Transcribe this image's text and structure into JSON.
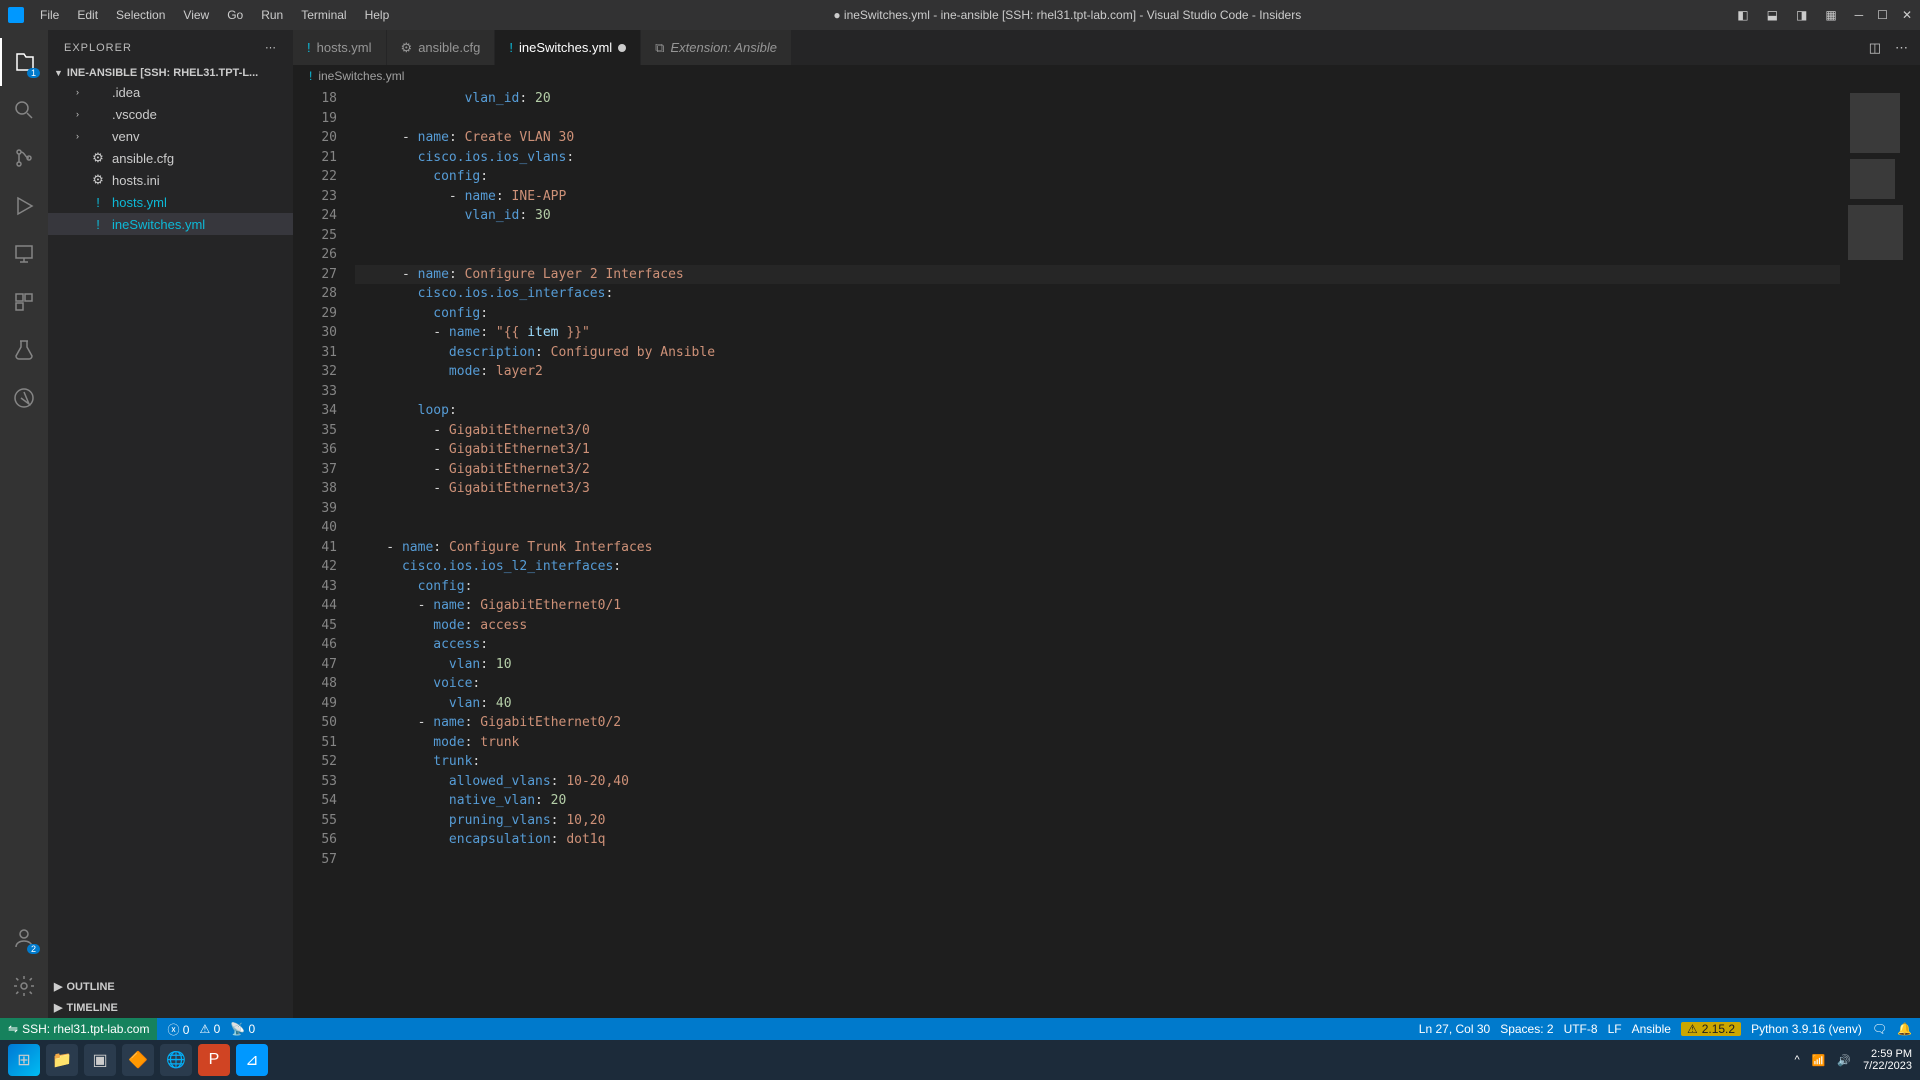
{
  "titlebar": {
    "menus": [
      "File",
      "Edit",
      "Selection",
      "View",
      "Go",
      "Run",
      "Terminal",
      "Help"
    ],
    "title": "● ineSwitches.yml - ine-ansible [SSH: rhel31.tpt-lab.com] - Visual Studio Code - Insiders"
  },
  "sidebar": {
    "header": "EXPLORER",
    "repo": "INE-ANSIBLE [SSH: RHEL31.TPT-L...",
    "files": [
      {
        "label": ".idea",
        "type": "folder"
      },
      {
        "label": ".vscode",
        "type": "folder"
      },
      {
        "label": "venv",
        "type": "folder"
      },
      {
        "label": "ansible.cfg",
        "type": "file",
        "icon": "⚙"
      },
      {
        "label": "hosts.ini",
        "type": "file",
        "icon": "⚙"
      },
      {
        "label": "hosts.yml",
        "type": "file",
        "icon": "!",
        "warn": true
      },
      {
        "label": "ineSwitches.yml",
        "type": "file",
        "icon": "!",
        "warn": true,
        "selected": true
      }
    ],
    "outline": "OUTLINE",
    "timeline": "TIMELINE"
  },
  "tabs": [
    {
      "label": "hosts.yml",
      "icon": "!",
      "warn": true
    },
    {
      "label": "ansible.cfg",
      "icon": "⚙"
    },
    {
      "label": "ineSwitches.yml",
      "icon": "!",
      "warn": true,
      "active": true,
      "dirty": true
    },
    {
      "label": "Extension: Ansible",
      "icon": "⧉",
      "italic": true
    }
  ],
  "breadcrumb": {
    "icon": "!",
    "label": "ineSwitches.yml"
  },
  "code_lines": [
    {
      "n": 18,
      "seg": [
        {
          "t": "              ",
          "c": "def"
        },
        {
          "t": "vlan_id",
          "c": "key"
        },
        {
          "t": ": ",
          "c": "def"
        },
        {
          "t": "20",
          "c": "num"
        }
      ]
    },
    {
      "n": 19,
      "seg": []
    },
    {
      "n": 20,
      "seg": [
        {
          "t": "      - ",
          "c": "def"
        },
        {
          "t": "name",
          "c": "key"
        },
        {
          "t": ": ",
          "c": "def"
        },
        {
          "t": "Create VLAN 30",
          "c": "txt"
        }
      ]
    },
    {
      "n": 21,
      "seg": [
        {
          "t": "        ",
          "c": "def"
        },
        {
          "t": "cisco.ios.ios_vlans",
          "c": "key"
        },
        {
          "t": ":",
          "c": "def"
        }
      ]
    },
    {
      "n": 22,
      "seg": [
        {
          "t": "          ",
          "c": "def"
        },
        {
          "t": "config",
          "c": "key"
        },
        {
          "t": ":",
          "c": "def"
        }
      ]
    },
    {
      "n": 23,
      "seg": [
        {
          "t": "            - ",
          "c": "def"
        },
        {
          "t": "name",
          "c": "key"
        },
        {
          "t": ": ",
          "c": "def"
        },
        {
          "t": "INE-APP",
          "c": "txt"
        }
      ]
    },
    {
      "n": 24,
      "seg": [
        {
          "t": "              ",
          "c": "def"
        },
        {
          "t": "vlan_id",
          "c": "key"
        },
        {
          "t": ": ",
          "c": "def"
        },
        {
          "t": "30",
          "c": "num"
        }
      ]
    },
    {
      "n": 25,
      "seg": []
    },
    {
      "n": 26,
      "seg": []
    },
    {
      "n": 27,
      "hl": true,
      "seg": [
        {
          "t": "      - ",
          "c": "def"
        },
        {
          "t": "name",
          "c": "key"
        },
        {
          "t": ": ",
          "c": "def"
        },
        {
          "t": "Configure Layer 2 Interfaces",
          "c": "txt"
        }
      ]
    },
    {
      "n": 28,
      "seg": [
        {
          "t": "        ",
          "c": "def"
        },
        {
          "t": "cisco.ios.ios_interfaces",
          "c": "key"
        },
        {
          "t": ":",
          "c": "def"
        }
      ]
    },
    {
      "n": 29,
      "seg": [
        {
          "t": "          ",
          "c": "def"
        },
        {
          "t": "config",
          "c": "key"
        },
        {
          "t": ":",
          "c": "def"
        }
      ]
    },
    {
      "n": 30,
      "seg": [
        {
          "t": "          - ",
          "c": "def"
        },
        {
          "t": "name",
          "c": "key"
        },
        {
          "t": ": ",
          "c": "def"
        },
        {
          "t": "\"{{ ",
          "c": "str"
        },
        {
          "t": "item",
          "c": "var"
        },
        {
          "t": " }}\"",
          "c": "str"
        }
      ]
    },
    {
      "n": 31,
      "seg": [
        {
          "t": "            ",
          "c": "def"
        },
        {
          "t": "description",
          "c": "key"
        },
        {
          "t": ": ",
          "c": "def"
        },
        {
          "t": "Configured by Ansible",
          "c": "txt"
        }
      ]
    },
    {
      "n": 32,
      "seg": [
        {
          "t": "            ",
          "c": "def"
        },
        {
          "t": "mode",
          "c": "key"
        },
        {
          "t": ": ",
          "c": "def"
        },
        {
          "t": "layer2",
          "c": "txt"
        }
      ]
    },
    {
      "n": 33,
      "seg": []
    },
    {
      "n": 34,
      "seg": [
        {
          "t": "        ",
          "c": "def"
        },
        {
          "t": "loop",
          "c": "key"
        },
        {
          "t": ":",
          "c": "def"
        }
      ]
    },
    {
      "n": 35,
      "seg": [
        {
          "t": "          - ",
          "c": "def"
        },
        {
          "t": "GigabitEthernet3/0",
          "c": "txt"
        }
      ]
    },
    {
      "n": 36,
      "seg": [
        {
          "t": "          - ",
          "c": "def"
        },
        {
          "t": "GigabitEthernet3/1",
          "c": "txt"
        }
      ]
    },
    {
      "n": 37,
      "seg": [
        {
          "t": "          - ",
          "c": "def"
        },
        {
          "t": "GigabitEthernet3/2",
          "c": "txt"
        }
      ]
    },
    {
      "n": 38,
      "seg": [
        {
          "t": "          - ",
          "c": "def"
        },
        {
          "t": "GigabitEthernet3/3",
          "c": "txt"
        }
      ]
    },
    {
      "n": 39,
      "seg": []
    },
    {
      "n": 40,
      "seg": []
    },
    {
      "n": 41,
      "seg": [
        {
          "t": "    - ",
          "c": "def"
        },
        {
          "t": "name",
          "c": "key"
        },
        {
          "t": ": ",
          "c": "def"
        },
        {
          "t": "Configure Trunk Interfaces",
          "c": "txt"
        }
      ]
    },
    {
      "n": 42,
      "seg": [
        {
          "t": "      ",
          "c": "def"
        },
        {
          "t": "cisco.ios.ios_l2_interfaces",
          "c": "key"
        },
        {
          "t": ":",
          "c": "def"
        }
      ]
    },
    {
      "n": 43,
      "seg": [
        {
          "t": "        ",
          "c": "def"
        },
        {
          "t": "config",
          "c": "key"
        },
        {
          "t": ":",
          "c": "def"
        }
      ]
    },
    {
      "n": 44,
      "seg": [
        {
          "t": "        - ",
          "c": "def"
        },
        {
          "t": "name",
          "c": "key"
        },
        {
          "t": ": ",
          "c": "def"
        },
        {
          "t": "GigabitEthernet0/1",
          "c": "txt"
        }
      ]
    },
    {
      "n": 45,
      "seg": [
        {
          "t": "          ",
          "c": "def"
        },
        {
          "t": "mode",
          "c": "key"
        },
        {
          "t": ": ",
          "c": "def"
        },
        {
          "t": "access",
          "c": "txt"
        }
      ]
    },
    {
      "n": 46,
      "seg": [
        {
          "t": "          ",
          "c": "def"
        },
        {
          "t": "access",
          "c": "key"
        },
        {
          "t": ":",
          "c": "def"
        }
      ]
    },
    {
      "n": 47,
      "seg": [
        {
          "t": "            ",
          "c": "def"
        },
        {
          "t": "vlan",
          "c": "key"
        },
        {
          "t": ": ",
          "c": "def"
        },
        {
          "t": "10",
          "c": "num"
        }
      ]
    },
    {
      "n": 48,
      "seg": [
        {
          "t": "          ",
          "c": "def"
        },
        {
          "t": "voice",
          "c": "key"
        },
        {
          "t": ":",
          "c": "def"
        }
      ]
    },
    {
      "n": 49,
      "seg": [
        {
          "t": "            ",
          "c": "def"
        },
        {
          "t": "vlan",
          "c": "key"
        },
        {
          "t": ": ",
          "c": "def"
        },
        {
          "t": "40",
          "c": "num"
        }
      ]
    },
    {
      "n": 50,
      "seg": [
        {
          "t": "        - ",
          "c": "def"
        },
        {
          "t": "name",
          "c": "key"
        },
        {
          "t": ": ",
          "c": "def"
        },
        {
          "t": "GigabitEthernet0/2",
          "c": "txt"
        }
      ]
    },
    {
      "n": 51,
      "seg": [
        {
          "t": "          ",
          "c": "def"
        },
        {
          "t": "mode",
          "c": "key"
        },
        {
          "t": ": ",
          "c": "def"
        },
        {
          "t": "trunk",
          "c": "txt"
        }
      ]
    },
    {
      "n": 52,
      "seg": [
        {
          "t": "          ",
          "c": "def"
        },
        {
          "t": "trunk",
          "c": "key"
        },
        {
          "t": ":",
          "c": "def"
        }
      ]
    },
    {
      "n": 53,
      "seg": [
        {
          "t": "            ",
          "c": "def"
        },
        {
          "t": "allowed_vlans",
          "c": "key"
        },
        {
          "t": ": ",
          "c": "def"
        },
        {
          "t": "10-20,40",
          "c": "txt"
        }
      ]
    },
    {
      "n": 54,
      "seg": [
        {
          "t": "            ",
          "c": "def"
        },
        {
          "t": "native_vlan",
          "c": "key"
        },
        {
          "t": ": ",
          "c": "def"
        },
        {
          "t": "20",
          "c": "num"
        }
      ]
    },
    {
      "n": 55,
      "seg": [
        {
          "t": "            ",
          "c": "def"
        },
        {
          "t": "pruning_vlans",
          "c": "key"
        },
        {
          "t": ": ",
          "c": "def"
        },
        {
          "t": "10,20",
          "c": "txt"
        }
      ]
    },
    {
      "n": 56,
      "seg": [
        {
          "t": "            ",
          "c": "def"
        },
        {
          "t": "encapsulation",
          "c": "key"
        },
        {
          "t": ": ",
          "c": "def"
        },
        {
          "t": "dot1q",
          "c": "txt"
        }
      ]
    },
    {
      "n": 57,
      "seg": []
    }
  ],
  "statusbar": {
    "remote": "SSH: rhel31.tpt-lab.com",
    "errors": "0",
    "warnings": "0",
    "ports": "0",
    "cursor": "Ln 27, Col 30",
    "spaces": "Spaces: 2",
    "encoding": "UTF-8",
    "eol": "LF",
    "language": "Ansible",
    "ansible_version": "2.15.2",
    "python": "Python 3.9.16 (venv)"
  },
  "taskbar": {
    "time": "2:59 PM",
    "date": "7/22/2023"
  }
}
